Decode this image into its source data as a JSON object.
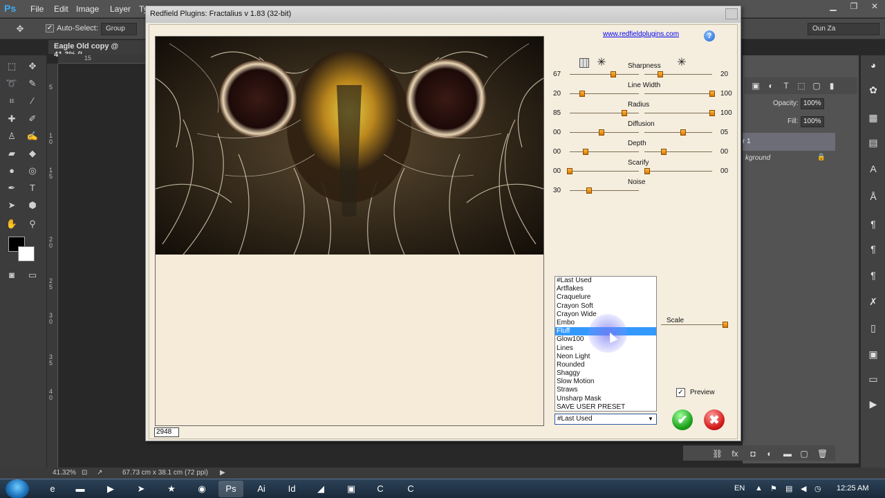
{
  "photoshop": {
    "logo": "Ps",
    "menu": [
      "File",
      "Edit",
      "Image",
      "Layer",
      "Ty"
    ],
    "options": {
      "auto_select_label": "Auto-Select:",
      "auto_select_checked": true,
      "group_value": "Group",
      "workspace": "Oun Za"
    },
    "document_tab": "Eagle Old copy @ 41.3% (L",
    "ruler_h_label": "15",
    "ruler_v_labels": [
      "5",
      "1 0",
      "1 5",
      "2 0",
      "2 5",
      "3 0",
      "3 5",
      "4 0"
    ],
    "layers": {
      "opacity_label": "Opacity:",
      "opacity_value": "100%",
      "fill_label": "Fill:",
      "fill_value": "100%",
      "layer1": "r 1",
      "background": "kground"
    },
    "status": {
      "zoom": "41.32%",
      "doc_size": "67.73 cm x 38.1 cm (72 ppi)"
    }
  },
  "taskbar": {
    "language": "EN",
    "time": "12:25 AM"
  },
  "dialog": {
    "title": "Redfield Plugins: Fractalius v 1.83 (32-bit)",
    "website": "www.redfieldplugins.com",
    "help_icon": "?",
    "size_readout": "2948",
    "params": [
      {
        "name": "Sharpness",
        "left_value": "67",
        "right_value": "20"
      },
      {
        "name": "Line Width",
        "left_value": "20",
        "right_value": "100"
      },
      {
        "name": "Radius",
        "left_value": "85",
        "right_value": "100"
      },
      {
        "name": "Diffusion",
        "left_value": "00",
        "right_value": "05"
      },
      {
        "name": "Depth",
        "left_value": "00",
        "right_value": "00"
      },
      {
        "name": "Scarify",
        "left_value": "00",
        "right_value": "00"
      },
      {
        "name": "Noise",
        "left_value": "30",
        "right_value": ""
      }
    ],
    "presets": [
      "#Last Used",
      "Artflakes",
      "Craquelure",
      "Crayon Soft",
      "Crayon Wide",
      "Embo",
      "Fluff",
      "Glow100",
      "Lines",
      "Neon Light",
      "Rounded",
      "Shaggy",
      "Slow Motion",
      "Straws",
      "Unsharp Mask",
      "SAVE USER PRESET"
    ],
    "selected_preset_index": 6,
    "combo_value": "#Last Used",
    "scale_label": "Scale",
    "preview_label": "Preview",
    "preview_checked": true,
    "ok_icon": "checkmark-icon",
    "cancel_icon": "x-icon"
  }
}
